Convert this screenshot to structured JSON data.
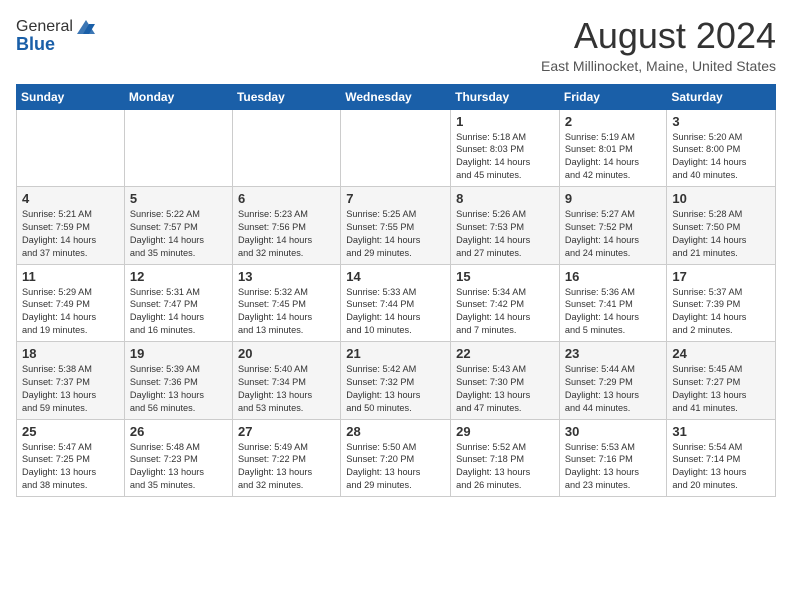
{
  "header": {
    "logo_general": "General",
    "logo_blue": "Blue",
    "month_title": "August 2024",
    "location": "East Millinocket, Maine, United States"
  },
  "weekdays": [
    "Sunday",
    "Monday",
    "Tuesday",
    "Wednesday",
    "Thursday",
    "Friday",
    "Saturday"
  ],
  "weeks": [
    [
      {
        "day": "",
        "info": ""
      },
      {
        "day": "",
        "info": ""
      },
      {
        "day": "",
        "info": ""
      },
      {
        "day": "",
        "info": ""
      },
      {
        "day": "1",
        "info": "Sunrise: 5:18 AM\nSunset: 8:03 PM\nDaylight: 14 hours\nand 45 minutes."
      },
      {
        "day": "2",
        "info": "Sunrise: 5:19 AM\nSunset: 8:01 PM\nDaylight: 14 hours\nand 42 minutes."
      },
      {
        "day": "3",
        "info": "Sunrise: 5:20 AM\nSunset: 8:00 PM\nDaylight: 14 hours\nand 40 minutes."
      }
    ],
    [
      {
        "day": "4",
        "info": "Sunrise: 5:21 AM\nSunset: 7:59 PM\nDaylight: 14 hours\nand 37 minutes."
      },
      {
        "day": "5",
        "info": "Sunrise: 5:22 AM\nSunset: 7:57 PM\nDaylight: 14 hours\nand 35 minutes."
      },
      {
        "day": "6",
        "info": "Sunrise: 5:23 AM\nSunset: 7:56 PM\nDaylight: 14 hours\nand 32 minutes."
      },
      {
        "day": "7",
        "info": "Sunrise: 5:25 AM\nSunset: 7:55 PM\nDaylight: 14 hours\nand 29 minutes."
      },
      {
        "day": "8",
        "info": "Sunrise: 5:26 AM\nSunset: 7:53 PM\nDaylight: 14 hours\nand 27 minutes."
      },
      {
        "day": "9",
        "info": "Sunrise: 5:27 AM\nSunset: 7:52 PM\nDaylight: 14 hours\nand 24 minutes."
      },
      {
        "day": "10",
        "info": "Sunrise: 5:28 AM\nSunset: 7:50 PM\nDaylight: 14 hours\nand 21 minutes."
      }
    ],
    [
      {
        "day": "11",
        "info": "Sunrise: 5:29 AM\nSunset: 7:49 PM\nDaylight: 14 hours\nand 19 minutes."
      },
      {
        "day": "12",
        "info": "Sunrise: 5:31 AM\nSunset: 7:47 PM\nDaylight: 14 hours\nand 16 minutes."
      },
      {
        "day": "13",
        "info": "Sunrise: 5:32 AM\nSunset: 7:45 PM\nDaylight: 14 hours\nand 13 minutes."
      },
      {
        "day": "14",
        "info": "Sunrise: 5:33 AM\nSunset: 7:44 PM\nDaylight: 14 hours\nand 10 minutes."
      },
      {
        "day": "15",
        "info": "Sunrise: 5:34 AM\nSunset: 7:42 PM\nDaylight: 14 hours\nand 7 minutes."
      },
      {
        "day": "16",
        "info": "Sunrise: 5:36 AM\nSunset: 7:41 PM\nDaylight: 14 hours\nand 5 minutes."
      },
      {
        "day": "17",
        "info": "Sunrise: 5:37 AM\nSunset: 7:39 PM\nDaylight: 14 hours\nand 2 minutes."
      }
    ],
    [
      {
        "day": "18",
        "info": "Sunrise: 5:38 AM\nSunset: 7:37 PM\nDaylight: 13 hours\nand 59 minutes."
      },
      {
        "day": "19",
        "info": "Sunrise: 5:39 AM\nSunset: 7:36 PM\nDaylight: 13 hours\nand 56 minutes."
      },
      {
        "day": "20",
        "info": "Sunrise: 5:40 AM\nSunset: 7:34 PM\nDaylight: 13 hours\nand 53 minutes."
      },
      {
        "day": "21",
        "info": "Sunrise: 5:42 AM\nSunset: 7:32 PM\nDaylight: 13 hours\nand 50 minutes."
      },
      {
        "day": "22",
        "info": "Sunrise: 5:43 AM\nSunset: 7:30 PM\nDaylight: 13 hours\nand 47 minutes."
      },
      {
        "day": "23",
        "info": "Sunrise: 5:44 AM\nSunset: 7:29 PM\nDaylight: 13 hours\nand 44 minutes."
      },
      {
        "day": "24",
        "info": "Sunrise: 5:45 AM\nSunset: 7:27 PM\nDaylight: 13 hours\nand 41 minutes."
      }
    ],
    [
      {
        "day": "25",
        "info": "Sunrise: 5:47 AM\nSunset: 7:25 PM\nDaylight: 13 hours\nand 38 minutes."
      },
      {
        "day": "26",
        "info": "Sunrise: 5:48 AM\nSunset: 7:23 PM\nDaylight: 13 hours\nand 35 minutes."
      },
      {
        "day": "27",
        "info": "Sunrise: 5:49 AM\nSunset: 7:22 PM\nDaylight: 13 hours\nand 32 minutes."
      },
      {
        "day": "28",
        "info": "Sunrise: 5:50 AM\nSunset: 7:20 PM\nDaylight: 13 hours\nand 29 minutes."
      },
      {
        "day": "29",
        "info": "Sunrise: 5:52 AM\nSunset: 7:18 PM\nDaylight: 13 hours\nand 26 minutes."
      },
      {
        "day": "30",
        "info": "Sunrise: 5:53 AM\nSunset: 7:16 PM\nDaylight: 13 hours\nand 23 minutes."
      },
      {
        "day": "31",
        "info": "Sunrise: 5:54 AM\nSunset: 7:14 PM\nDaylight: 13 hours\nand 20 minutes."
      }
    ]
  ]
}
